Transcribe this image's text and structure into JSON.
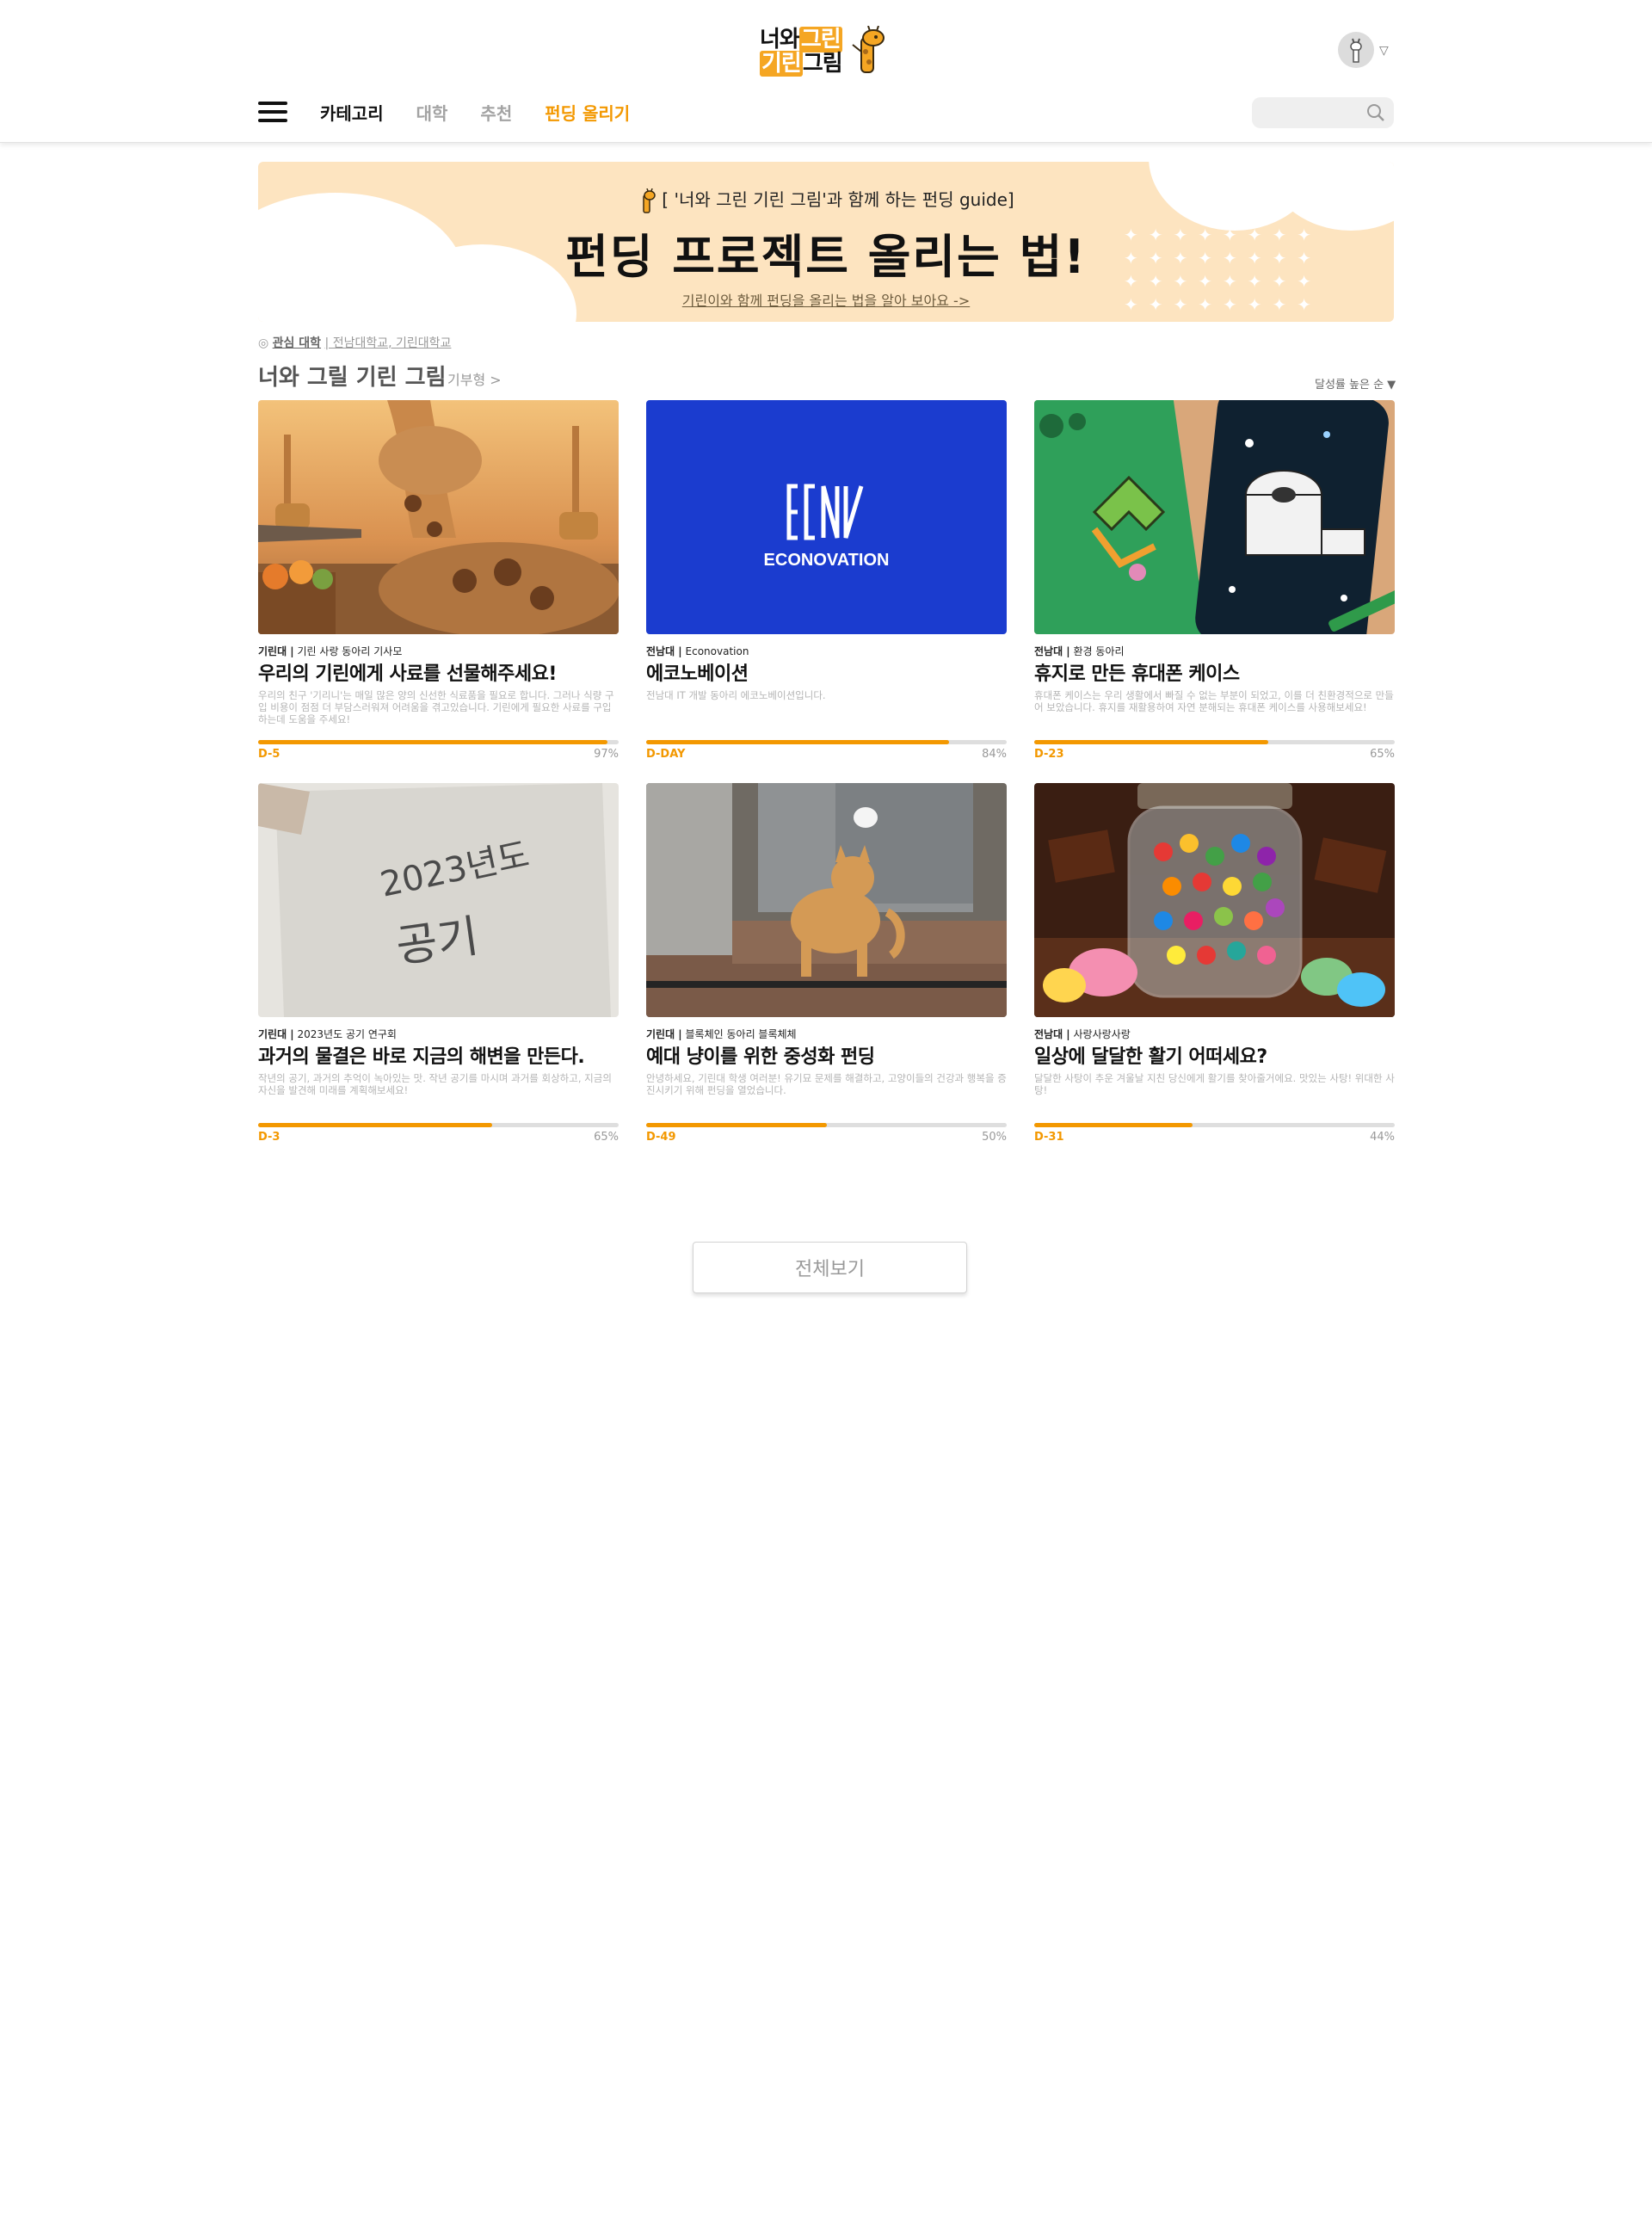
{
  "header": {
    "logo_line1_a": "너와",
    "logo_line1_b": "그린",
    "logo_line2_a": "기린",
    "logo_line2_b": "그림",
    "accent_color": "#f39800"
  },
  "nav": {
    "menu_icon": "hamburger-menu-icon",
    "items": [
      {
        "label": "카테고리"
      },
      {
        "label": "대학"
      },
      {
        "label": "추천"
      },
      {
        "label": "펀딩 올리기"
      }
    ]
  },
  "search": {
    "placeholder": "",
    "icon": "search-icon"
  },
  "banner": {
    "guide": "[ '너와 그린 기린 그림'과 함께 하는 펀딩 guide]",
    "title": "펀딩 프로젝트 올리는 법!",
    "link": "기린이와 함께 펀딩을 올리는 법을 알아 보아요 ->"
  },
  "interest": {
    "label": "관심 대학",
    "schools": "| 전남대학교, 기린대학교"
  },
  "section": {
    "title": "너와 그릴 기린 그림",
    "sub": "기부형 >",
    "sort": "달성률 높은 순 ▼"
  },
  "cards": [
    {
      "school": "기린대 |",
      "club": "기린 사랑 동아리 기사모",
      "title": "우리의 기린에게 사료를 선물해주세요!",
      "desc": "우리의 친구 '기리니'는 매일 많은 양의 신선한 식료품을 필요로 합니다. 그러나 식량 구입 비용이 점점 더 부담스러워져 어려움을 겪고있습니다. 기린에게 필요한 사료를 구입하는데 도움을 주세요!",
      "dday": "D-5",
      "percent_label": "97%",
      "progress": 0.97
    },
    {
      "school": "전남대 |",
      "club": "Econovation",
      "title": "에코노베이션",
      "desc": "전남대 IT 개발 동아리 에코노베이션입니다.",
      "dday": "D-DAY",
      "percent_label": "84%",
      "progress": 0.84,
      "logo_text": "ECONOVATION"
    },
    {
      "school": "전남대 |",
      "club": "환경 동아리",
      "title": "휴지로 만든 휴대폰 케이스",
      "desc": "휴대폰 케이스는 우리 생활에서 빠질 수 없는 부분이 되었고, 이를 더 친환경적으로 만들어 보았습니다. 휴지를 재활용하여 자연 분해되는 휴대폰 케이스를 사용해보세요!",
      "dday": "D-23",
      "percent_label": "65%",
      "progress": 0.65
    },
    {
      "school": "기린대 |",
      "club": "2023년도 공기 연구회",
      "title": "과거의 물결은 바로 지금의 해변을 만든다.",
      "desc": "작년의 공기, 과거의 추억이 녹아있는 맛. 작년 공기를 마시며 과거를 회상하고, 지금의 자신을 발견해 미래를 계획해보세요!",
      "dday": "D-3",
      "percent_label": "65%",
      "progress": 0.65,
      "photo_text_1": "2023년도",
      "photo_text_2": "공기"
    },
    {
      "school": "기린대 |",
      "club": "블록체인 동아리 블록체체",
      "title": "예대 냥이를 위한 중성화 펀딩",
      "desc": "안녕하세요, 기린대 학생 여러분! 유기묘 문제를 해결하고, 고양이들의 건강과 행복을 증진시키기 위해 펀딩을 열었습니다.",
      "dday": "D-49",
      "percent_label": "50%",
      "progress": 0.5
    },
    {
      "school": "전남대 |",
      "club": "사랑사랑사랑",
      "title": "일상에 달달한 활기 어떠세요?",
      "desc": "달달한 사탕이 추운 겨울날 지친 당신에게 활기를 찾아줄거에요. 맛있는 사탕! 위대한 사탕!",
      "dday": "D-31",
      "percent_label": "44%",
      "progress": 0.44
    }
  ],
  "view_all": "전체보기"
}
